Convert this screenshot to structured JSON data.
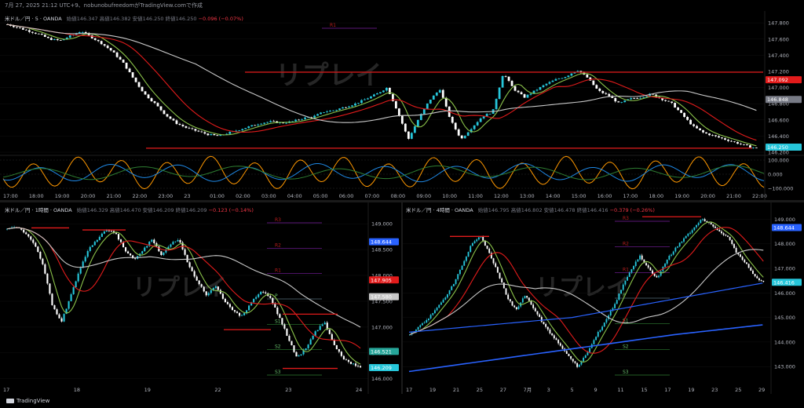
{
  "header": {
    "text": "7月 27, 2025 21:12 UTC+9、nobunobufreedomがTradingView.comで作成"
  },
  "footer": {
    "brand": "TradingView"
  },
  "watermark": "リプレイ",
  "colors": {
    "up": "#26c6da",
    "down": "#ffffff",
    "red": "#e21b1b",
    "green": "#8bc34a",
    "white_ma": "#c8c8c8",
    "blue_line": "#2962ff",
    "osc_orange": "#ff9800",
    "osc_blue": "#1e88e5",
    "osc_green": "#2e7d32"
  },
  "charts": [
    {
      "id": "m5",
      "legend": {
        "symbol": "米ドル／円 · 5 · OANDA",
        "ohlc": "始値146.347 高値146.382 安値146.250 終値146.250",
        "change": "−0.096 (−0.07%)"
      },
      "y_ticks": [
        "147.800",
        "147.600",
        "147.400",
        "147.200",
        "147.000",
        "146.800",
        "146.600",
        "146.400",
        "146.200"
      ],
      "x_ticks": [
        "17:00",
        "18:00",
        "19:00",
        "20:00",
        "21:00",
        "22:00",
        "23:00",
        "23",
        "01:00",
        "02:00",
        "03:00",
        "04:00",
        "05:00",
        "06:00",
        "07:00",
        "08:00",
        "09:00",
        "10:00",
        "11:00",
        "12:00",
        "13:00",
        "14:00",
        "15:00",
        "16:00",
        "17:00",
        "18:00",
        "19:00",
        "20:00",
        "21:00",
        "22:00"
      ],
      "price_tags": [
        {
          "value": "147.092",
          "color": "#e21b1b"
        },
        {
          "value": "146.848",
          "color": "#787b86"
        },
        {
          "value": "146.250",
          "color": "#26c6da"
        }
      ],
      "level_labels": [
        "R1"
      ],
      "oscillator": {
        "y_ticks": [
          "100.000",
          "0.000",
          "−100.000"
        ]
      },
      "chart_data": {
        "type": "line",
        "title": "米ドル／円 · 5 · OANDA",
        "ylim": [
          146.2,
          147.85
        ],
        "series": [
          {
            "name": "price",
            "values": [
              147.78,
              147.74,
              147.7,
              147.66,
              147.6,
              147.58,
              147.64,
              147.7,
              147.62,
              147.54,
              147.44,
              147.3,
              147.1,
              146.92,
              146.8,
              146.66,
              146.56,
              146.5,
              146.46,
              146.42,
              146.4,
              146.44,
              146.48,
              146.52,
              146.56,
              146.58,
              146.56,
              146.58,
              146.62,
              146.64,
              146.7,
              146.72,
              146.76,
              146.8,
              146.86,
              146.92,
              147.0,
              146.7,
              146.36,
              146.62,
              146.84,
              146.98,
              146.6,
              146.36,
              146.5,
              146.64,
              146.7,
              147.18,
              146.98,
              146.88,
              146.96,
              147.04,
              147.1,
              147.14,
              147.22,
              147.12,
              146.96,
              146.9,
              146.8,
              146.86,
              146.88,
              146.92,
              146.86,
              146.8,
              146.66,
              146.52,
              146.44,
              146.4,
              146.36,
              146.32,
              146.28,
              146.25
            ]
          }
        ]
      }
    },
    {
      "id": "h1",
      "legend": {
        "symbol": "米ドル／円 · 1時間 · OANDA",
        "ohlc": "始値146.329 高値146.470 安値146.209 終値146.209",
        "change": "−0.123 (−0.14%)"
      },
      "y_ticks": [
        "149.000",
        "148.500",
        "148.000",
        "147.500",
        "147.000",
        "146.500",
        "146.000"
      ],
      "x_ticks": [
        "17",
        "18",
        "19",
        "22",
        "23",
        "24"
      ],
      "price_tags": [
        {
          "value": "148.644",
          "color": "#2962ff"
        },
        {
          "value": "147.905",
          "color": "#e21b1b"
        },
        {
          "value": "147.580",
          "color": "#c8c8c8"
        },
        {
          "value": "146.521",
          "color": "#26a69a"
        },
        {
          "value": "146.209",
          "color": "#26c6da"
        }
      ],
      "level_labels": [
        "R3",
        "R2",
        "R1",
        "P",
        "S1",
        "S2",
        "S3"
      ],
      "chart_data": {
        "type": "line",
        "title": "米ドル／円 · 1時間 · OANDA",
        "ylim": [
          145.95,
          149.2
        ],
        "series": [
          {
            "name": "price",
            "values": [
              148.9,
              148.95,
              148.82,
              148.6,
              148.2,
              147.4,
              147.1,
              147.6,
              148.1,
              148.5,
              148.7,
              148.9,
              148.8,
              148.5,
              148.3,
              148.5,
              148.7,
              148.4,
              148.6,
              148.7,
              148.2,
              147.9,
              147.6,
              147.8,
              147.5,
              147.3,
              147.2,
              147.5,
              147.7,
              147.6,
              147.2,
              146.8,
              146.4,
              146.6,
              146.9,
              147.1,
              146.7,
              146.4,
              146.3,
              146.21
            ]
          }
        ]
      }
    },
    {
      "id": "h4",
      "legend": {
        "symbol": "米ドル／円 · 4時間 · OANDA",
        "ohlc": "始値146.795 高値146.802 安値146.478 終値146.416",
        "change": "−0.379 (−0.26%)"
      },
      "y_ticks": [
        "149.000",
        "148.000",
        "147.000",
        "146.000",
        "145.000",
        "144.000",
        "143.000"
      ],
      "x_ticks": [
        "17",
        "19",
        "21",
        "25",
        "27",
        "7月",
        "3",
        "5",
        "9",
        "11",
        "15",
        "17",
        "19",
        "23",
        "25",
        "29"
      ],
      "price_tags": [
        {
          "value": "148.644",
          "color": "#2962ff"
        },
        {
          "value": "146.416",
          "color": "#26c6da"
        }
      ],
      "level_labels": [
        "R3",
        "R2",
        "R1",
        "P",
        "S1",
        "S2",
        "S3"
      ],
      "chart_data": {
        "type": "line",
        "title": "米ドル／円 · 4時間 · OANDA",
        "ylim": [
          142.4,
          149.3
        ],
        "series": [
          {
            "name": "price",
            "values": [
              144.3,
              144.6,
              144.9,
              145.4,
              145.8,
              146.4,
              147.2,
              148.0,
              148.3,
              147.6,
              146.8,
              145.8,
              145.3,
              145.9,
              145.4,
              144.8,
              144.3,
              143.9,
              143.4,
              143.0,
              143.5,
              144.2,
              144.8,
              145.4,
              146.2,
              146.9,
              147.5,
              147.0,
              146.6,
              147.3,
              147.8,
              148.2,
              148.6,
              149.0,
              148.8,
              148.5,
              148.3,
              147.6,
              147.2,
              146.7,
              146.42
            ]
          },
          {
            "name": "blue",
            "values": [
              144.4,
              144.45,
              144.5,
              144.55,
              144.6,
              144.65,
              144.7,
              144.75,
              144.8,
              144.85,
              144.9,
              144.95,
              145.0,
              145.1,
              145.2,
              145.3,
              145.4,
              145.5,
              145.6,
              145.7,
              145.8,
              145.9,
              146.0,
              146.1,
              146.2,
              146.3,
              146.4
            ]
          },
          {
            "name": "trend",
            "values": [
              142.8,
              143.3,
              143.8,
              144.3,
              144.7
            ]
          }
        ]
      }
    }
  ]
}
